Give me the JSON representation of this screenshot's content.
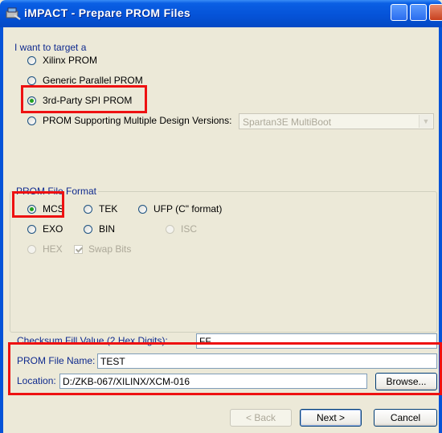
{
  "window": {
    "title": "iMPACT - Prepare PROM Files",
    "icon": "impact-app-icon"
  },
  "target": {
    "heading": "I want to target a",
    "options": [
      {
        "label": "Xilinx PROM",
        "checked": false
      },
      {
        "label": "Generic Parallel PROM",
        "checked": false
      },
      {
        "label": "3rd-Party SPI PROM",
        "checked": true
      },
      {
        "label": "PROM Supporting Multiple Design Versions:",
        "checked": false
      }
    ],
    "multiboot_select": {
      "value": "Spartan3E MultiBoot",
      "enabled": false
    }
  },
  "format": {
    "heading": "PROM File Format",
    "options": [
      {
        "label": "MCS",
        "checked": true,
        "enabled": true
      },
      {
        "label": "TEK",
        "checked": false,
        "enabled": true
      },
      {
        "label": "UFP (C\" format)",
        "checked": false,
        "enabled": true
      },
      {
        "label": "EXO",
        "checked": false,
        "enabled": true
      },
      {
        "label": "BIN",
        "checked": false,
        "enabled": true
      },
      {
        "label": "ISC",
        "checked": false,
        "enabled": false
      },
      {
        "label": "HEX",
        "checked": false,
        "enabled": false
      }
    ],
    "swap_bits": {
      "label": "Swap Bits",
      "checked": true,
      "enabled": false
    }
  },
  "checksum": {
    "label": "Checksum Fill Value (2 Hex Digits):",
    "value": "FF"
  },
  "file_name": {
    "label": "PROM File Name:",
    "value": "TEST"
  },
  "location": {
    "label": "Location:",
    "value": "D:/ZKB-067/XILINX/XCM-016",
    "browse": "Browse..."
  },
  "buttons": {
    "back": "< Back",
    "next": "Next >",
    "cancel": "Cancel"
  },
  "colors": {
    "title_bar": "#0553d8",
    "dialog_bg": "#ece9d8",
    "highlight": "#ee1111",
    "label_text": "#0f2a8e"
  }
}
